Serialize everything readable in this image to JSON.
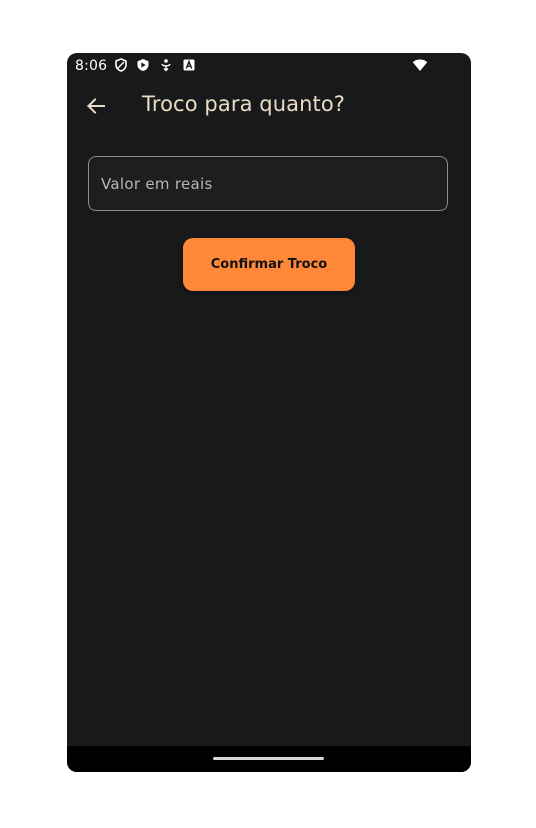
{
  "status_bar": {
    "time": "8:06",
    "icons": [
      "vpn-shield-icon",
      "play-store-icon",
      "notification-icon",
      "font-a-icon",
      "wifi-icon"
    ]
  },
  "app_bar": {
    "back_icon": "arrow-left-icon",
    "title": "Troco para quanto?"
  },
  "form": {
    "amount_placeholder": "Valor em reais",
    "amount_value": "",
    "confirm_label": "Confirmar Troco"
  },
  "colors": {
    "background": "#18191a",
    "title": "#e9dcc4",
    "accent_button": "#ff8838",
    "nav_bar": "#000000"
  }
}
